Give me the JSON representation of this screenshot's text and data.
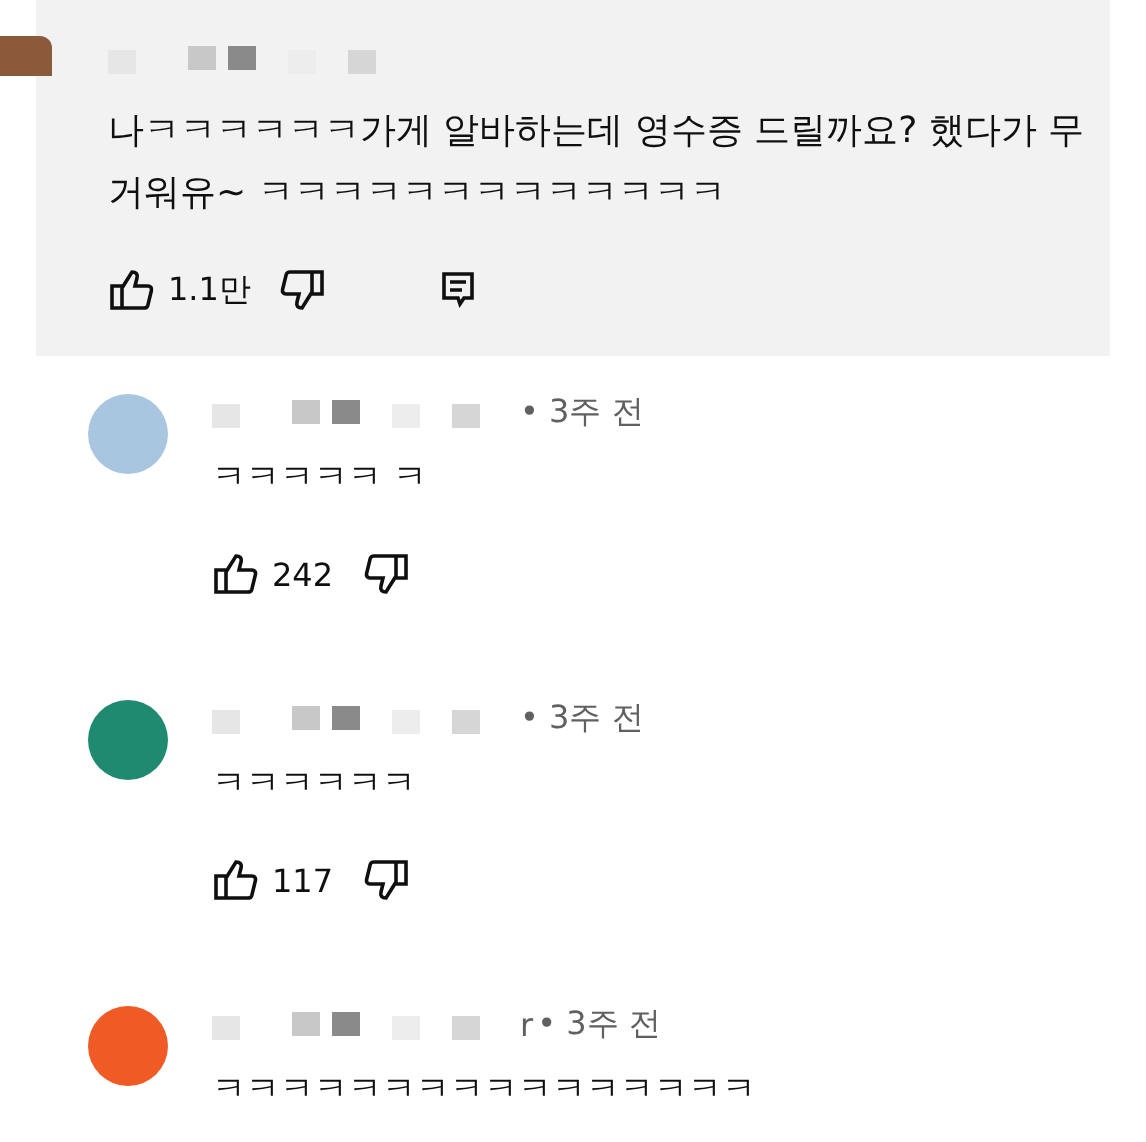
{
  "comments": [
    {
      "kind": "highlighted",
      "color": "#8a5a3a",
      "text": "나ㅋㅋㅋㅋㅋㅋ가게 알바하는데 영수증 드릴까요? 했다가 무거워유~ ㅋㅋㅋㅋㅋㅋㅋㅋㅋㅋㅋㅋㅋ",
      "likes": "1.1만"
    },
    {
      "kind": "reply",
      "color": "#a9c6e0",
      "time": "• 3주 전",
      "text": "ㅋㅋㅋㅋㅋ ㅋ",
      "likes": "242"
    },
    {
      "kind": "reply",
      "color": "#1f8a70",
      "time": "• 3주 전",
      "text": "ㅋㅋㅋㅋㅋㅋ",
      "likes": "117"
    },
    {
      "kind": "reply",
      "color": "#f05a24",
      "name_tail": "r",
      "time": "• 3주 전",
      "text": "ㅋㅋㅋㅋㅋㅋㅋㅋㅋㅋㅋㅋㅋㅋㅋㅋ"
    }
  ]
}
